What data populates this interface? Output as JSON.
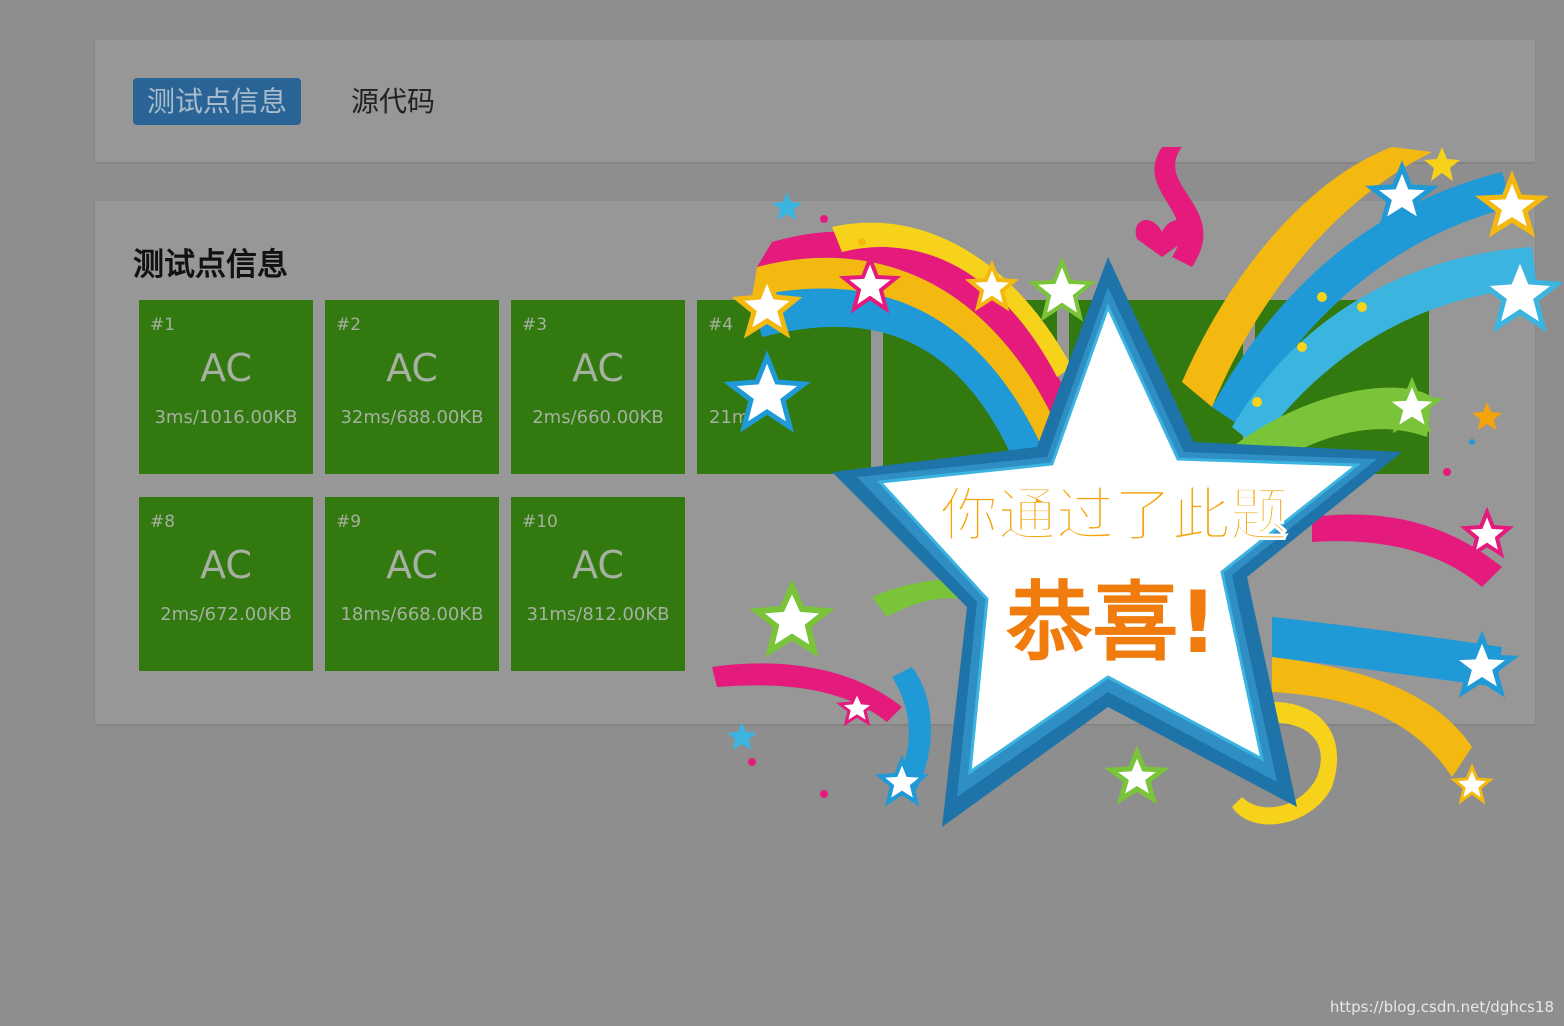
{
  "tabs": [
    {
      "label": "测试点信息",
      "active": true
    },
    {
      "label": "源代码",
      "active": false
    }
  ],
  "section_title": "测试点信息",
  "testcases": [
    {
      "num": "#1",
      "status": "AC",
      "stats": "3ms/1016.00KB"
    },
    {
      "num": "#2",
      "status": "AC",
      "stats": "32ms/688.00KB"
    },
    {
      "num": "#3",
      "status": "AC",
      "stats": "2ms/660.00KB"
    },
    {
      "num": "#4",
      "status": "",
      "stats": "21m"
    },
    {
      "num": "",
      "status": "",
      "stats": ""
    },
    {
      "num": "",
      "status": "",
      "stats": ""
    },
    {
      "num": "",
      "status": "",
      "stats": ""
    },
    {
      "num": "#8",
      "status": "AC",
      "stats": "2ms/672.00KB"
    },
    {
      "num": "#9",
      "status": "AC",
      "stats": "18ms/668.00KB"
    },
    {
      "num": "#10",
      "status": "AC",
      "stats": "31ms/812.00KB"
    }
  ],
  "overlay": {
    "line1": "你通过了此题",
    "line2": "恭喜!"
  },
  "watermark": "https://blog.csdn.net/dghcs18",
  "colors": {
    "accepted": "#32790f",
    "tab_active": "#2a6496",
    "star_border": "#1e73a8",
    "text_orange": "#f4a30b",
    "text_orange_dark": "#f07c0e"
  }
}
